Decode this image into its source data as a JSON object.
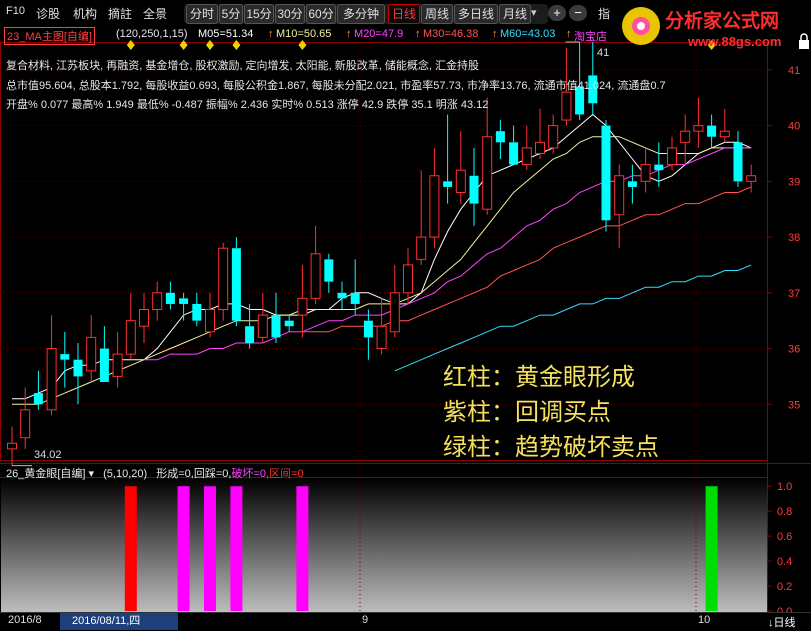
{
  "toolbar": {
    "left_items": [
      "F10",
      "诊股",
      "机构",
      "摘註",
      "全景"
    ],
    "periods": [
      "分时",
      "5分",
      "15分",
      "30分",
      "60分",
      "多分钟",
      "日线",
      "周线",
      "多日线",
      "月线"
    ],
    "active_period": "日线",
    "more_indicator": "▾",
    "plus": "+",
    "minus": "−",
    "extra": "指"
  },
  "brand": {
    "name": "分析家公式网",
    "url": "www.88gs.com"
  },
  "ma_legend": {
    "indicator": "23_MA主图[自编]",
    "params": "(120,250,1,15)",
    "ma05": "M05=51.34",
    "ma10": "M10=50.65",
    "ma20": "M20=47.9",
    "ma30": "M30=46.38",
    "ma60": "M60=43.03",
    "extra": "淘宝店",
    "arrow": "↑"
  },
  "info": {
    "concepts": "复合材料, 江苏板块, 再融资, 基金增仓, 股权激励, 定向增发, 太阳能, 新股改革, 储能概念, 汇金持股",
    "fundamentals": "总市值95.604, 总股本1.792, 每股收益0.693, 每股公积金1.867, 每股未分配2.021, 市盈率57.73, 市净率13.76, 流通市值41.024, 流通盘0.7",
    "quote": "开盘% 0.077  最高% 1.949  最低% -0.487  振幅% 2.436  实时% 0.513  涨停 42.9  跌停 35.1  明涨 43.12"
  },
  "overlay": {
    "line1": "红柱：黄金眼形成",
    "line2": "紫柱：回调买点",
    "line3": "绿柱：趋势破坏卖点"
  },
  "sub_legend": {
    "indicator": "26_黄金眼[自编]",
    "params": "(5,10,20)",
    "formation": "形成=0,",
    "pullback": "回踩=0,",
    "breakdown": "破坏=0,",
    "range": "区间=0"
  },
  "bottom": {
    "month_label": "2016/8",
    "cursor_date": "2016/08/11,四",
    "tick_9": "9",
    "tick_10": "10",
    "period_switch": "↓日线"
  },
  "colors": {
    "up": "#ff3030",
    "down": "#00ffff",
    "ma5": "#ffffff",
    "ma10": "#f2f2a0",
    "ma20": "#ff44ff",
    "ma30": "#ff5555",
    "ma60": "#33ddff",
    "formation": "#ff0000",
    "pullback": "#ff00ff",
    "breakdown": "#00dd00"
  },
  "chart_data": [
    {
      "type": "candlestick",
      "ylim": [
        34,
        41.5
      ],
      "y_ticks": [
        35,
        36,
        37,
        38,
        39,
        40,
        41
      ],
      "labels": {
        "high": "41",
        "low": "34.02"
      },
      "candles": [
        {
          "o": 34.2,
          "h": 34.6,
          "l": 33.9,
          "c": 34.3
        },
        {
          "o": 34.4,
          "h": 35.3,
          "l": 34.2,
          "c": 34.9
        },
        {
          "o": 35.2,
          "h": 35.6,
          "l": 34.9,
          "c": 35.0
        },
        {
          "o": 34.9,
          "h": 36.6,
          "l": 34.8,
          "c": 36.0
        },
        {
          "o": 35.9,
          "h": 36.3,
          "l": 35.3,
          "c": 35.8
        },
        {
          "o": 35.8,
          "h": 36.1,
          "l": 35.0,
          "c": 35.5
        },
        {
          "o": 35.6,
          "h": 36.6,
          "l": 35.4,
          "c": 36.2
        },
        {
          "o": 36.0,
          "h": 36.4,
          "l": 35.4,
          "c": 35.4
        },
        {
          "o": 35.5,
          "h": 36.3,
          "l": 35.3,
          "c": 35.9
        },
        {
          "o": 35.9,
          "h": 37.0,
          "l": 35.8,
          "c": 36.5
        },
        {
          "o": 36.4,
          "h": 37.0,
          "l": 36.1,
          "c": 36.7
        },
        {
          "o": 36.7,
          "h": 37.2,
          "l": 36.5,
          "c": 37.0
        },
        {
          "o": 37.0,
          "h": 37.2,
          "l": 36.7,
          "c": 36.8
        },
        {
          "o": 36.9,
          "h": 37.0,
          "l": 36.5,
          "c": 36.8
        },
        {
          "o": 36.8,
          "h": 37.0,
          "l": 36.4,
          "c": 36.5
        },
        {
          "o": 36.3,
          "h": 37.0,
          "l": 36.2,
          "c": 36.7
        },
        {
          "o": 36.7,
          "h": 37.9,
          "l": 36.5,
          "c": 37.8
        },
        {
          "o": 37.8,
          "h": 38.0,
          "l": 36.4,
          "c": 36.5
        },
        {
          "o": 36.4,
          "h": 36.8,
          "l": 36.0,
          "c": 36.1
        },
        {
          "o": 36.2,
          "h": 37.0,
          "l": 36.1,
          "c": 36.6
        },
        {
          "o": 36.6,
          "h": 37.0,
          "l": 36.1,
          "c": 36.2
        },
        {
          "o": 36.5,
          "h": 36.6,
          "l": 36.3,
          "c": 36.4
        },
        {
          "o": 36.6,
          "h": 37.5,
          "l": 36.2,
          "c": 36.9
        },
        {
          "o": 36.9,
          "h": 38.2,
          "l": 36.8,
          "c": 37.7
        },
        {
          "o": 37.6,
          "h": 37.7,
          "l": 37.0,
          "c": 37.2
        },
        {
          "o": 37.0,
          "h": 37.2,
          "l": 36.7,
          "c": 36.9
        },
        {
          "o": 37.0,
          "h": 37.6,
          "l": 36.6,
          "c": 36.8
        },
        {
          "o": 36.5,
          "h": 36.7,
          "l": 35.8,
          "c": 36.2
        },
        {
          "o": 36.0,
          "h": 36.9,
          "l": 35.9,
          "c": 36.4
        },
        {
          "o": 36.3,
          "h": 37.5,
          "l": 36.2,
          "c": 37.0
        },
        {
          "o": 37.0,
          "h": 37.8,
          "l": 36.8,
          "c": 37.5
        },
        {
          "o": 37.6,
          "h": 39.2,
          "l": 37.5,
          "c": 38.0
        },
        {
          "o": 38.0,
          "h": 39.6,
          "l": 37.8,
          "c": 39.1
        },
        {
          "o": 39.0,
          "h": 40.2,
          "l": 38.6,
          "c": 38.9
        },
        {
          "o": 38.8,
          "h": 39.9,
          "l": 38.6,
          "c": 39.2
        },
        {
          "o": 39.1,
          "h": 39.6,
          "l": 38.2,
          "c": 38.6
        },
        {
          "o": 38.5,
          "h": 40.5,
          "l": 38.4,
          "c": 39.8
        },
        {
          "o": 39.9,
          "h": 40.1,
          "l": 39.4,
          "c": 39.7
        },
        {
          "o": 39.7,
          "h": 40.0,
          "l": 39.3,
          "c": 39.3
        },
        {
          "o": 39.3,
          "h": 40.0,
          "l": 39.2,
          "c": 39.6
        },
        {
          "o": 39.5,
          "h": 40.3,
          "l": 39.4,
          "c": 39.7
        },
        {
          "o": 39.6,
          "h": 40.2,
          "l": 39.5,
          "c": 40.0
        },
        {
          "o": 40.1,
          "h": 41.4,
          "l": 40.0,
          "c": 40.6
        },
        {
          "o": 40.7,
          "h": 41.5,
          "l": 40.1,
          "c": 40.2
        },
        {
          "o": 40.9,
          "h": 41.5,
          "l": 40.2,
          "c": 40.4
        },
        {
          "o": 40.0,
          "h": 40.1,
          "l": 38.1,
          "c": 38.3
        },
        {
          "o": 38.4,
          "h": 39.3,
          "l": 37.8,
          "c": 39.1
        },
        {
          "o": 39.0,
          "h": 39.3,
          "l": 38.6,
          "c": 38.9
        },
        {
          "o": 39.0,
          "h": 39.6,
          "l": 38.8,
          "c": 39.3
        },
        {
          "o": 39.3,
          "h": 39.7,
          "l": 38.9,
          "c": 39.2
        },
        {
          "o": 39.3,
          "h": 39.8,
          "l": 39.2,
          "c": 39.6
        },
        {
          "o": 39.7,
          "h": 40.2,
          "l": 39.3,
          "c": 39.9
        },
        {
          "o": 39.9,
          "h": 40.5,
          "l": 39.6,
          "c": 40.0
        },
        {
          "o": 40.0,
          "h": 40.2,
          "l": 39.6,
          "c": 39.8
        },
        {
          "o": 39.8,
          "h": 40.3,
          "l": 39.7,
          "c": 39.9
        },
        {
          "o": 39.7,
          "h": 39.9,
          "l": 38.9,
          "c": 39.0
        },
        {
          "o": 39.0,
          "h": 39.3,
          "l": 38.8,
          "c": 39.1
        }
      ],
      "series": [
        {
          "key": "ma5",
          "values": [
            35.1,
            35.1,
            35.2,
            35.3,
            35.6,
            35.7,
            35.7,
            35.8,
            35.8,
            35.8,
            35.8,
            36.0,
            36.3,
            36.6,
            36.7,
            36.7,
            36.8,
            36.8,
            36.7,
            36.7,
            36.6,
            36.6,
            36.6,
            36.7,
            36.7,
            36.9,
            37.0,
            37.0,
            36.9,
            36.8,
            36.8,
            37.0,
            37.6,
            38.1,
            38.5,
            38.8,
            39.1,
            39.2,
            39.3,
            39.4,
            39.5,
            39.6,
            39.8,
            40.0,
            40.2,
            40.0,
            39.7,
            39.4,
            39.1,
            39.0,
            39.1,
            39.3,
            39.5,
            39.6,
            39.7,
            39.7,
            39.6
          ]
        },
        {
          "key": "ma10",
          "values": [
            35.0,
            35.0,
            35.0,
            35.1,
            35.2,
            35.3,
            35.4,
            35.5,
            35.6,
            35.7,
            35.8,
            35.9,
            36.0,
            36.1,
            36.2,
            36.3,
            36.4,
            36.5,
            36.5,
            36.5,
            36.6,
            36.6,
            36.7,
            36.7,
            36.7,
            36.7,
            36.7,
            36.8,
            36.8,
            36.8,
            36.9,
            37.0,
            37.2,
            37.4,
            37.6,
            37.9,
            38.2,
            38.5,
            38.8,
            39.0,
            39.2,
            39.4,
            39.5,
            39.7,
            39.8,
            39.8,
            39.8,
            39.7,
            39.6,
            39.5,
            39.5,
            39.5,
            39.5,
            39.6,
            39.6,
            39.6,
            39.6
          ]
        },
        {
          "key": "ma20",
          "values": [
            null,
            null,
            null,
            null,
            null,
            null,
            null,
            null,
            null,
            null,
            35.8,
            35.8,
            35.9,
            35.9,
            35.9,
            36.0,
            36.0,
            36.1,
            36.1,
            36.1,
            36.2,
            36.3,
            36.3,
            36.4,
            36.5,
            36.5,
            36.6,
            36.6,
            36.6,
            36.7,
            36.8,
            36.9,
            37.0,
            37.2,
            37.3,
            37.5,
            37.7,
            37.8,
            38.0,
            38.2,
            38.3,
            38.5,
            38.6,
            38.8,
            38.9,
            39.0,
            39.0,
            39.1,
            39.1,
            39.2,
            39.3,
            39.3,
            39.4,
            39.5,
            39.6,
            39.6,
            39.6
          ]
        },
        {
          "key": "ma30",
          "values": [
            null,
            null,
            null,
            null,
            null,
            null,
            null,
            null,
            null,
            null,
            null,
            null,
            null,
            null,
            null,
            null,
            null,
            null,
            null,
            null,
            null,
            null,
            36.3,
            36.3,
            36.3,
            36.4,
            36.4,
            36.4,
            36.4,
            36.5,
            36.5,
            36.6,
            36.7,
            36.8,
            36.9,
            37.0,
            37.1,
            37.3,
            37.4,
            37.5,
            37.6,
            37.8,
            37.9,
            38.0,
            38.1,
            38.2,
            38.2,
            38.3,
            38.4,
            38.4,
            38.5,
            38.6,
            38.6,
            38.7,
            38.8,
            38.8,
            38.9
          ]
        },
        {
          "key": "ma60",
          "values": [
            null,
            null,
            null,
            null,
            null,
            null,
            null,
            null,
            null,
            null,
            null,
            null,
            null,
            null,
            null,
            null,
            null,
            null,
            null,
            null,
            null,
            null,
            null,
            null,
            null,
            null,
            null,
            null,
            null,
            35.6,
            35.7,
            35.8,
            35.9,
            36.0,
            36.1,
            36.2,
            36.3,
            36.4,
            36.4,
            36.5,
            36.6,
            36.6,
            36.7,
            36.8,
            36.8,
            36.9,
            36.9,
            37.0,
            37.1,
            37.1,
            37.2,
            37.2,
            37.3,
            37.3,
            37.4,
            37.4,
            37.5
          ]
        }
      ]
    },
    {
      "type": "bar",
      "ylim": [
        0,
        1.05
      ],
      "y_ticks": [
        0,
        0.2,
        0.4,
        0.6,
        0.8,
        1.0
      ],
      "signals": [
        {
          "index": 9,
          "kind": "formation",
          "value": 1
        },
        {
          "index": 13,
          "kind": "pullback",
          "value": 1
        },
        {
          "index": 15,
          "kind": "pullback",
          "value": 1
        },
        {
          "index": 17,
          "kind": "pullback",
          "value": 1
        },
        {
          "index": 22,
          "kind": "pullback",
          "value": 1
        },
        {
          "index": 53,
          "kind": "breakdown",
          "value": 1
        }
      ]
    }
  ]
}
